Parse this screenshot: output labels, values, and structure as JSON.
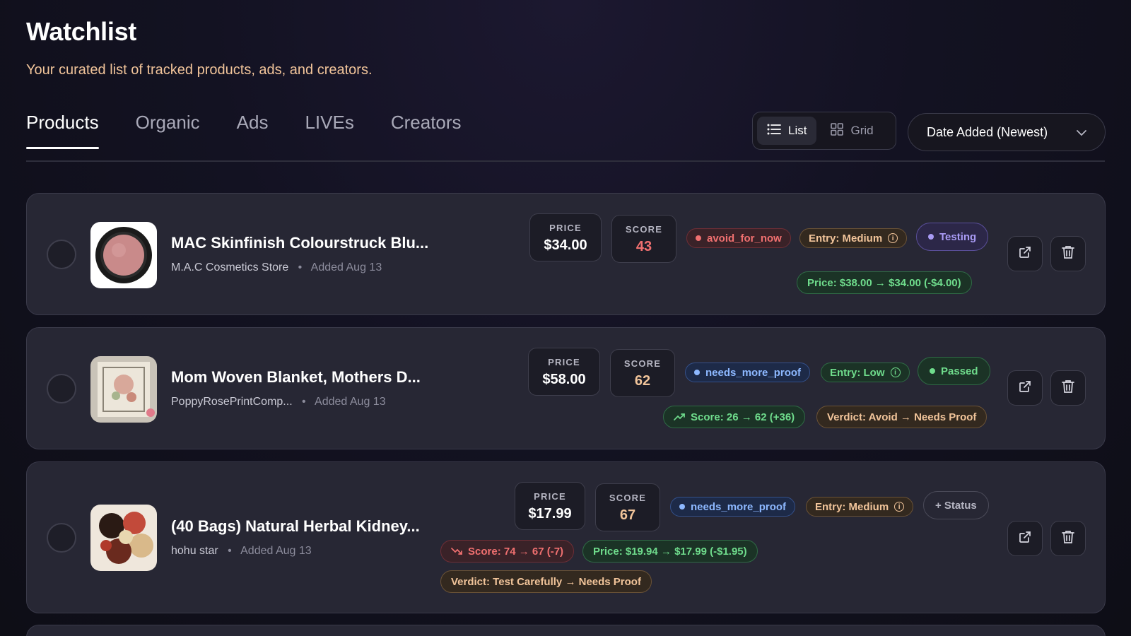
{
  "header": {
    "title": "Watchlist",
    "subtitle": "Your curated list of tracked products, ads, and creators."
  },
  "tabs": [
    {
      "label": "Products",
      "active": true
    },
    {
      "label": "Organic",
      "active": false
    },
    {
      "label": "Ads",
      "active": false
    },
    {
      "label": "LIVEs",
      "active": false
    },
    {
      "label": "Creators",
      "active": false
    }
  ],
  "view_toggle": {
    "list_label": "List",
    "grid_label": "Grid",
    "selected": "List"
  },
  "sort": {
    "value": "Date Added (Newest)"
  },
  "labels": {
    "price": "PRICE",
    "score": "SCORE"
  },
  "colors": {
    "accent_tan": "#f1c49a",
    "score_red": "#f07070",
    "score_tan": "#f1c49a",
    "green": "#6fdc8c",
    "blue": "#8db8ff",
    "purple": "#a99bf5"
  },
  "products": [
    {
      "name": "MAC Skinfinish Colourstruck Blu...",
      "store": "M.A.C Cosmetics Store",
      "added": "Added Aug 13",
      "price": "$34.00",
      "score": "43",
      "recommendation": "avoid_for_now",
      "entry": "Entry: Medium",
      "status": "Testing",
      "changes": [
        "Price: $38.00 → $34.00 (-$4.00)"
      ]
    },
    {
      "name": "Mom Woven Blanket, Mothers D...",
      "store": "PoppyRosePrintComp...",
      "added": "Added Aug 13",
      "price": "$58.00",
      "score": "62",
      "recommendation": "needs_more_proof",
      "entry": "Entry: Low",
      "status": "Passed",
      "changes": [
        "Score: 26 → 62 (+36)",
        "Verdict: Avoid → Needs Proof"
      ]
    },
    {
      "name": "(40 Bags) Natural Herbal Kidney...",
      "store": "hohu star",
      "added": "Added Aug 13",
      "price": "$17.99",
      "score": "67",
      "recommendation": "needs_more_proof",
      "entry": "Entry: Medium",
      "status": "+ Status",
      "changes": [
        "Score: 74 → 67 (-7)",
        "Price: $19.94 → $17.99 (-$1.95)",
        "Verdict: Test Carefully → Needs Proof"
      ]
    }
  ]
}
